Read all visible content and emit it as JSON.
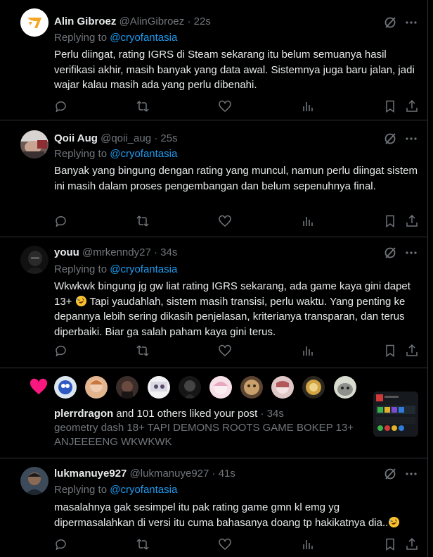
{
  "notifications": [
    {
      "name": "Alin Gibroez",
      "handle": "@AlinGibroez",
      "separator": "·",
      "time": "22s",
      "replying_label": "Replying to",
      "replying_to": "@cryofantasia",
      "text": "Perlu diingat, rating IGRS di Steam sekarang itu belum semuanya hasil verifikasi akhir, masih banyak yang data awal. Sistemnya juga baru jalan, jadi wajar kalau masih ada yang perlu dibenahi."
    },
    {
      "name": "Qoii Aug",
      "handle": "@qoii_aug",
      "separator": "·",
      "time": "25s",
      "replying_label": "Replying to",
      "replying_to": "@cryofantasia",
      "text": "Banyak yang bingung dengan rating yang muncul, namun perlu diingat sistem ini masih dalam proses pengembangan dan belum sepenuhnya final."
    },
    {
      "name": "youu",
      "handle": "@mrkenndy27",
      "separator": "·",
      "time": "34s",
      "replying_label": "Replying to",
      "replying_to": "@cryofantasia",
      "text_before_emoji": "Wkwkwk bingung jg gw liat rating IGRS sekarang, ada game kaya gini dapet 13+",
      "emoji": "rolling-on-floor-laughing",
      "text_after_emoji": " Tapi yaudahlah, sistem masih transisi, perlu waktu. Yang penting ke depannya lebih sering dikasih penjelasan, kriterianya transparan, dan terus diperbaiki. Biar ga salah paham kaya gini terus."
    },
    {
      "name": "lukmanuye927",
      "handle": "@lukmanuye927",
      "separator": "·",
      "time": "41s",
      "replying_label": "Replying to",
      "replying_to": "@cryofantasia",
      "text_before_emoji": "masalahnya gak sesimpel itu pak rating game gmn kl emg yg dipermasalahkan di versi itu cuma bahasanya doang tp hakikatnya dia..",
      "emoji": "rolling-on-floor-laughing",
      "text_after_emoji": ""
    }
  ],
  "like_notification": {
    "icon": "heart-icon",
    "liked_by": "plerrdragon",
    "liked_suffix": " and 101 others liked your post",
    "separator": "·",
    "time": "34s",
    "post_text": "geometry dash 18+ TAPI DEMONS ROOTS GAME BOKEP 13+ ANJEEEENG WKWKWK"
  },
  "colors": {
    "background": "#000000",
    "text": "#e7e9ea",
    "secondary": "#71767b",
    "accent": "#1d9bf0",
    "like": "#f91880",
    "border": "#2f3336"
  }
}
